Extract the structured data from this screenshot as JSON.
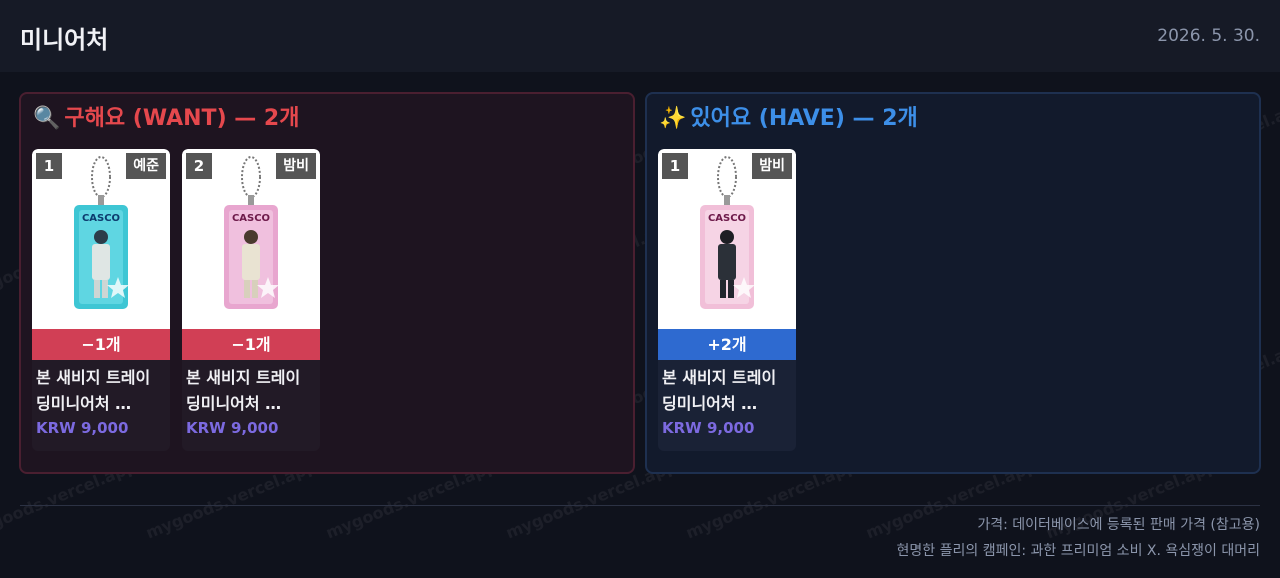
{
  "header": {
    "title": "미니어처",
    "date": "2026. 5. 30."
  },
  "want": {
    "emoji": "🔍",
    "title": "구해요 (WANT) — 2개",
    "cards": [
      {
        "rank": "1",
        "member": "예준",
        "count": "−1개",
        "name_line1": "본 새비지 트레이",
        "name_line2": "딩미니어처 …",
        "price": "KRW 9,000",
        "color": "#3ec6d4",
        "figure": "#dfe6e4"
      },
      {
        "rank": "2",
        "member": "밤비",
        "count": "−1개",
        "name_line1": "본 새비지 트레이",
        "name_line2": "딩미니어처 …",
        "price": "KRW 9,000",
        "color": "#e8a6cf",
        "figure": "#e9e3d2"
      }
    ]
  },
  "have": {
    "emoji": "✨",
    "title": "있어요 (HAVE) — 2개",
    "cards": [
      {
        "rank": "1",
        "member": "밤비",
        "count": "+2개",
        "name_line1": "본 새비지 트레이",
        "name_line2": "딩미니어처 …",
        "price": "KRW 9,000",
        "color": "#f1bfd8",
        "figure": "#2b3038"
      }
    ]
  },
  "footer": {
    "note1": "가격: 데이터베이스에 등록된 판매 가격 (참고용)",
    "note2": "현명한 플리의 캠페인: 과한 프리미엄 소비 X. 욕심쟁이 대머리"
  },
  "watermark": "mygoods.vercel.app"
}
